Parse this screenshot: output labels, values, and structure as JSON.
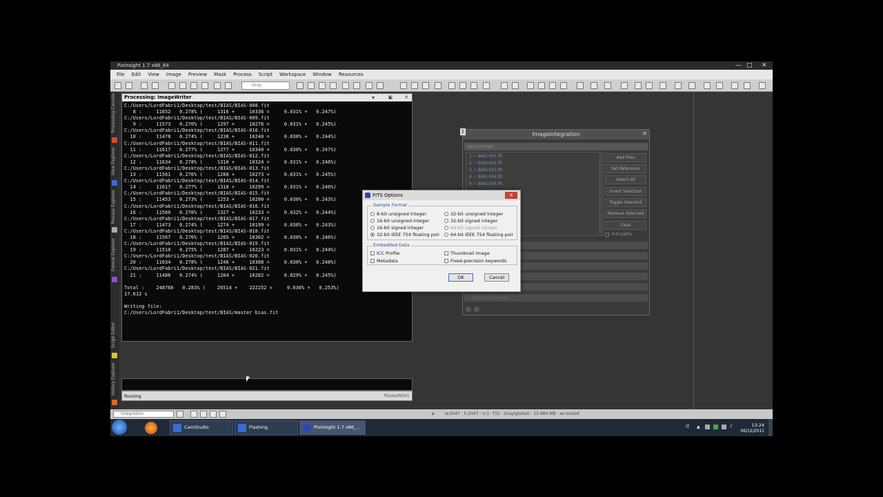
{
  "window": {
    "title": "PixInsight 1.7 x86_64",
    "controls": [
      "—",
      "□",
      "✕"
    ]
  },
  "menu": [
    "File",
    "Edit",
    "View",
    "Image",
    "Preview",
    "Mask",
    "Process",
    "Script",
    "Workspace",
    "Window",
    "Resources"
  ],
  "toolbar": {
    "color_space": "Gray"
  },
  "side_tabs": [
    "Processing Console",
    "View Explorer",
    "Process Explorer",
    "Format Explorer",
    "Script Editor",
    "History Explorer"
  ],
  "console": {
    "title": "Processing: ImageWriter",
    "lines": [
      "C:/Users/LordFabri1/Desktop/test/BIAS/BIAS-008.fit",
      "   8 :     11652   0.278% (     1316 +     10336 =     0.031% +   0.247%)",
      "C:/Users/LordFabri1/Desktop/test/BIAS/BIAS-009.fit",
      "   9 :     11573   0.276% (     1297 +     10276 =     0.031% +   0.245%)",
      "C:/Users/LordFabri1/Desktop/test/BIAS/BIAS-010.fit",
      "  10 :     11478   0.274% (     1238 +     10240 =     0.030% +   0.244%)",
      "C:/Users/LordFabri1/Desktop/test/BIAS/BIAS-011.fit",
      "  11 :     11617   0.277% (     1277 +     10340 =     0.030% +   0.247%)",
      "C:/Users/LordFabri1/Desktop/test/BIAS/BIAS-012.fit",
      "  12 :     11634   0.278% (     1310 +     10324 =     0.031% +   0.246%)",
      "C:/Users/LordFabri1/Desktop/test/BIAS/BIAS-013.fit",
      "  13 :     11561   0.276% (     1288 +     10273 =     0.031% +   0.245%)",
      "C:/Users/LordFabri1/Desktop/test/BIAS/BIAS-014.fit",
      "  14 :     11617   0.277% (     1318 +     10299 =     0.031% +   0.246%)",
      "C:/Users/LordFabri1/Desktop/test/BIAS/BIAS-015.fit",
      "  15 :     11453   0.273% (     1253 +     10200 =     0.030% +   0.243%)",
      "C:/Users/LordFabri1/Desktop/test/BIAS/BIAS-016.fit",
      "  16 :     11560   0.276% (     1327 +     10233 =     0.032% +   0.244%)",
      "C:/Users/LordFabri1/Desktop/test/BIAS/BIAS-017.fit",
      "  17 :     11473   0.274% (     1274 +     10199 =     0.030% +   0.243%)",
      "C:/Users/LordFabri1/Desktop/test/BIAS/BIAS-018.fit",
      "  18 :     11567   0.276% (     1265 +     10302 =     0.030% +   0.246%)",
      "C:/Users/LordFabri1/Desktop/test/BIAS/BIAS-019.fit",
      "  19 :     11510   0.275% (     1287 +     10223 =     0.031% +   0.244%)",
      "C:/Users/LordFabri1/Desktop/test/BIAS/BIAS-020.fit",
      "  20 :     11634   0.278% (     1246 +     10388 =     0.030% +   0.248%)",
      "C:/Users/LordFabri1/Desktop/test/BIAS/BIAS-021.fit",
      "  21 :     11486   0.274% (     1204 +     10282 =     0.029% +   0.245%)",
      "",
      "Total :    248766   0.283% (    26514 +    222252 =     0.030% +   0.253%)",
      "17.612 s",
      "",
      "Writing file:",
      "C:/Users/LordFabri1/Desktop/test/BIAS/master bias.fit"
    ],
    "status": "Running",
    "pause_label": "Pause/Abort"
  },
  "image_integration": {
    "title": "ImageIntegration",
    "input_header": "Input Images",
    "files": [
      "1 ✓ BIAS-001.fit",
      "2 ✓ BIAS-002.fit",
      "3 ✓ BIAS-003.fit",
      "4 ✓ BIAS-004.fit",
      "5 ✓ BIAS-005.fit"
    ],
    "buttons": [
      "Add Files",
      "Set Reference",
      "Select All",
      "Invert Selection",
      "Toggle Selected",
      "Remove Selected",
      "Clear"
    ],
    "full_paths": "Full paths",
    "last_section": "Region of Interest"
  },
  "fits": {
    "title": "FITS Options",
    "sample_format_label": "Sample Format",
    "formats_left": [
      "8-bit unsigned integer",
      "16-bit unsigned integer",
      "16-bit signed integer",
      "32-bit IEEE 754 floating poir"
    ],
    "formats_right": [
      "32-bit unsigned integer",
      "32-bit signed integer",
      "64-bit signed integer",
      "64-bit IEEE 754 floating poir"
    ],
    "embedded_label": "Embedded Data",
    "icc": "ICC Profile",
    "metadata": "Metadata",
    "thumbnail": "Thumbnail Image",
    "keywords": "Fixed-precision keywords",
    "ok": "OK",
    "cancel": "Cancel"
  },
  "bottom": {
    "view": "integration",
    "status": "w:2047 · h:2047 · n:1 · f32 · Gray(global) · 15.984 MB · wr-locked"
  },
  "taskbar": {
    "apps": [
      "CamStudio",
      "Flashing",
      "PixInsight 1.7 x86_..."
    ],
    "lang": "IT",
    "time": "13:24",
    "date": "06/12/2011"
  }
}
